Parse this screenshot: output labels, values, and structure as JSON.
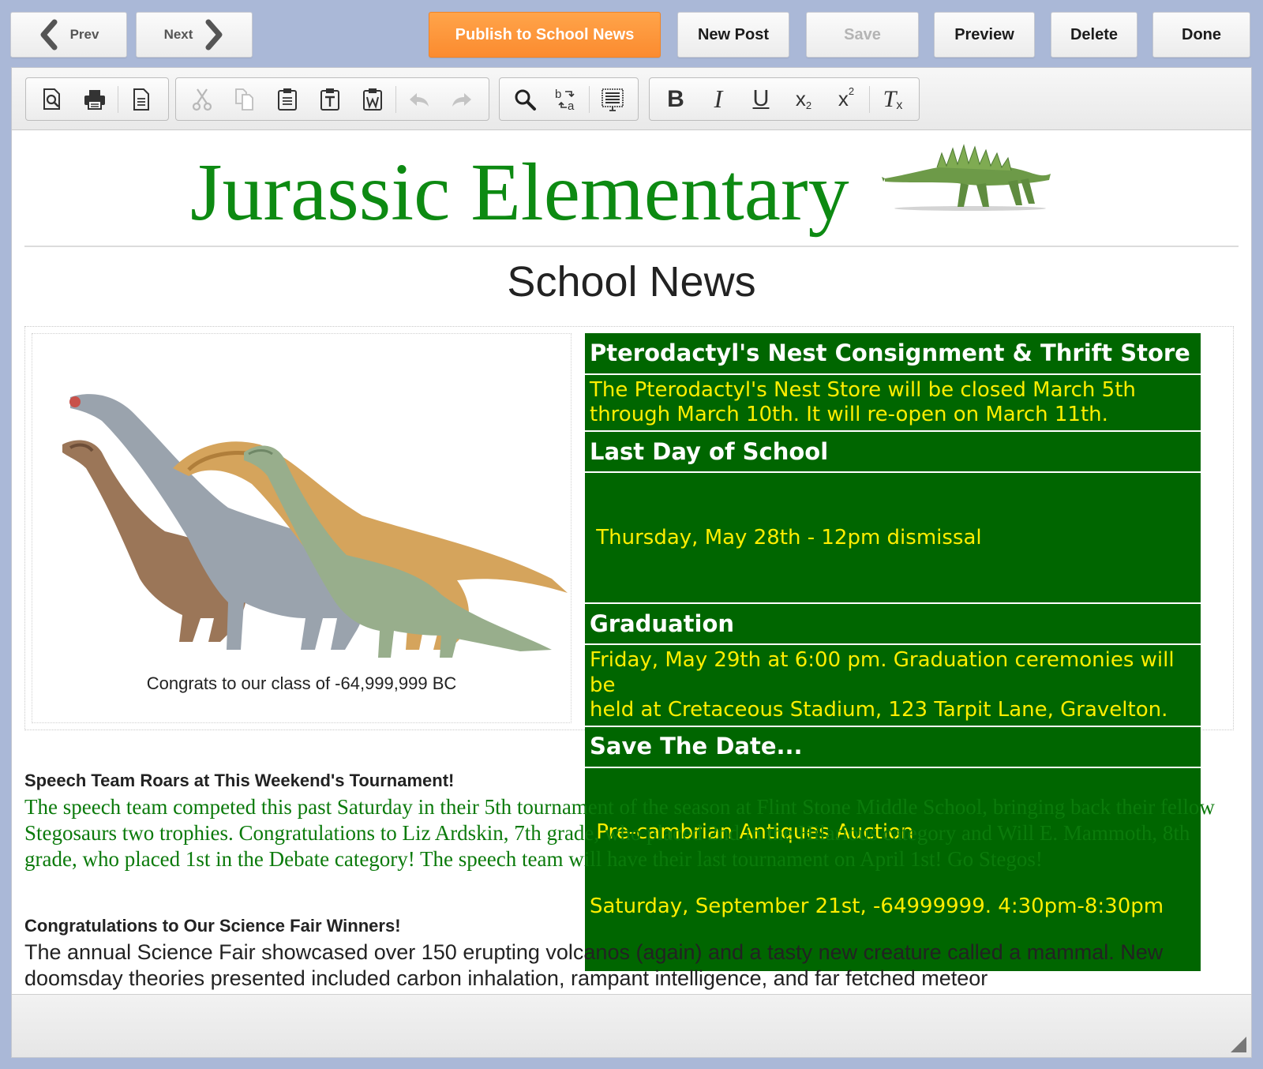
{
  "nav": {
    "prev": "Prev",
    "next": "Next"
  },
  "actions": {
    "publish": "Publish to School News",
    "new_post": "New Post",
    "save": "Save",
    "preview": "Preview",
    "delete": "Delete",
    "done": "Done"
  },
  "toolbar_icons": [
    "preview-icon",
    "print-icon",
    "new-document-icon",
    "cut-icon",
    "copy-icon",
    "paste-icon",
    "paste-text-icon",
    "paste-word-icon",
    "undo-icon",
    "redo-icon",
    "find-icon",
    "replace-icon",
    "show-blocks-icon",
    "bold-icon",
    "italic-icon",
    "underline-icon",
    "subscript-icon",
    "superscript-icon",
    "remove-format-icon"
  ],
  "masthead": {
    "school_name": "Jurassic Elementary"
  },
  "section_title": "School News",
  "feature": {
    "caption": "Congrats to our class of -64,999,999 BC",
    "events": [
      {
        "title": "Pterodactyl's Nest Consignment & Thrift Store",
        "lines": [
          "The Pterodactyl's Nest Store will be closed March 5th",
          "through March 10th. It will re-open on March 11th."
        ]
      },
      {
        "title": "Last Day of School",
        "lines": [
          " Thursday, May 28th - 12pm dismissal"
        ]
      },
      {
        "title": "Graduation",
        "lines": [
          "Friday, May 29th at 6:00 pm. Graduation ceremonies will be",
          "held at Cretaceous Stadium, 123 Tarpit Lane, Gravelton."
        ]
      },
      {
        "title": "Save The Date...",
        "lines": [
          " Pre-cambrian Antiques Auction",
          "Saturday, September 21st, -64999999. 4:30pm-8:30pm"
        ]
      }
    ]
  },
  "articles": [
    {
      "headline": "Speech Team Roars at This Weekend's Tournament!",
      "body": "The speech team competed this past Saturday in their 5th tournament of the season at Flint Stone Middle School, bringing back their fellow Stegosaurs two trophies. Congratulations to Liz Ardskin, 7th grade, who placed 2nd in the Hilarious category and Will E. Mammoth, 8th grade, who placed 1st in the Debate category! The speech team will have their last tournament on April 1st! Go Stegos!"
    },
    {
      "headline": "Congratulations to Our Science Fair Winners!",
      "body": "The annual Science Fair showcased over 150 erupting volcanos (again) and a tasty new creature called a mammal. New doomsday theories presented included carbon inhalation, rampant intelligence, and far fetched meteor"
    }
  ],
  "colors": {
    "brand_green": "#0d8a12",
    "event_bg": "#006600",
    "event_text": "#ffee00",
    "publish_orange": "#fb8b2f"
  }
}
